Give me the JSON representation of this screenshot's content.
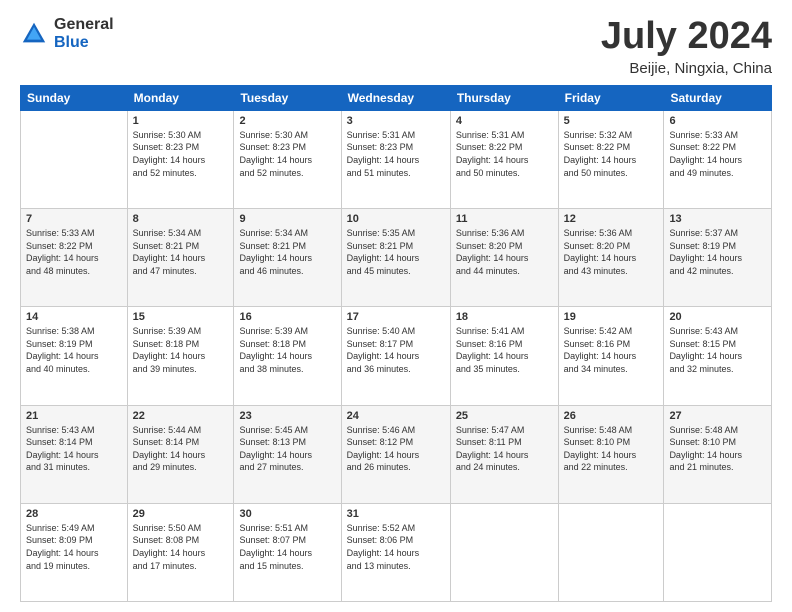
{
  "logo": {
    "general": "General",
    "blue": "Blue"
  },
  "header": {
    "title": "July 2024",
    "subtitle": "Beijie, Ningxia, China"
  },
  "weekdays": [
    "Sunday",
    "Monday",
    "Tuesday",
    "Wednesday",
    "Thursday",
    "Friday",
    "Saturday"
  ],
  "weeks": [
    [
      {
        "day": "",
        "content": ""
      },
      {
        "day": "1",
        "content": "Sunrise: 5:30 AM\nSunset: 8:23 PM\nDaylight: 14 hours\nand 52 minutes."
      },
      {
        "day": "2",
        "content": "Sunrise: 5:30 AM\nSunset: 8:23 PM\nDaylight: 14 hours\nand 52 minutes."
      },
      {
        "day": "3",
        "content": "Sunrise: 5:31 AM\nSunset: 8:23 PM\nDaylight: 14 hours\nand 51 minutes."
      },
      {
        "day": "4",
        "content": "Sunrise: 5:31 AM\nSunset: 8:22 PM\nDaylight: 14 hours\nand 50 minutes."
      },
      {
        "day": "5",
        "content": "Sunrise: 5:32 AM\nSunset: 8:22 PM\nDaylight: 14 hours\nand 50 minutes."
      },
      {
        "day": "6",
        "content": "Sunrise: 5:33 AM\nSunset: 8:22 PM\nDaylight: 14 hours\nand 49 minutes."
      }
    ],
    [
      {
        "day": "7",
        "content": "Sunrise: 5:33 AM\nSunset: 8:22 PM\nDaylight: 14 hours\nand 48 minutes."
      },
      {
        "day": "8",
        "content": "Sunrise: 5:34 AM\nSunset: 8:21 PM\nDaylight: 14 hours\nand 47 minutes."
      },
      {
        "day": "9",
        "content": "Sunrise: 5:34 AM\nSunset: 8:21 PM\nDaylight: 14 hours\nand 46 minutes."
      },
      {
        "day": "10",
        "content": "Sunrise: 5:35 AM\nSunset: 8:21 PM\nDaylight: 14 hours\nand 45 minutes."
      },
      {
        "day": "11",
        "content": "Sunrise: 5:36 AM\nSunset: 8:20 PM\nDaylight: 14 hours\nand 44 minutes."
      },
      {
        "day": "12",
        "content": "Sunrise: 5:36 AM\nSunset: 8:20 PM\nDaylight: 14 hours\nand 43 minutes."
      },
      {
        "day": "13",
        "content": "Sunrise: 5:37 AM\nSunset: 8:19 PM\nDaylight: 14 hours\nand 42 minutes."
      }
    ],
    [
      {
        "day": "14",
        "content": "Sunrise: 5:38 AM\nSunset: 8:19 PM\nDaylight: 14 hours\nand 40 minutes."
      },
      {
        "day": "15",
        "content": "Sunrise: 5:39 AM\nSunset: 8:18 PM\nDaylight: 14 hours\nand 39 minutes."
      },
      {
        "day": "16",
        "content": "Sunrise: 5:39 AM\nSunset: 8:18 PM\nDaylight: 14 hours\nand 38 minutes."
      },
      {
        "day": "17",
        "content": "Sunrise: 5:40 AM\nSunset: 8:17 PM\nDaylight: 14 hours\nand 36 minutes."
      },
      {
        "day": "18",
        "content": "Sunrise: 5:41 AM\nSunset: 8:16 PM\nDaylight: 14 hours\nand 35 minutes."
      },
      {
        "day": "19",
        "content": "Sunrise: 5:42 AM\nSunset: 8:16 PM\nDaylight: 14 hours\nand 34 minutes."
      },
      {
        "day": "20",
        "content": "Sunrise: 5:43 AM\nSunset: 8:15 PM\nDaylight: 14 hours\nand 32 minutes."
      }
    ],
    [
      {
        "day": "21",
        "content": "Sunrise: 5:43 AM\nSunset: 8:14 PM\nDaylight: 14 hours\nand 31 minutes."
      },
      {
        "day": "22",
        "content": "Sunrise: 5:44 AM\nSunset: 8:14 PM\nDaylight: 14 hours\nand 29 minutes."
      },
      {
        "day": "23",
        "content": "Sunrise: 5:45 AM\nSunset: 8:13 PM\nDaylight: 14 hours\nand 27 minutes."
      },
      {
        "day": "24",
        "content": "Sunrise: 5:46 AM\nSunset: 8:12 PM\nDaylight: 14 hours\nand 26 minutes."
      },
      {
        "day": "25",
        "content": "Sunrise: 5:47 AM\nSunset: 8:11 PM\nDaylight: 14 hours\nand 24 minutes."
      },
      {
        "day": "26",
        "content": "Sunrise: 5:48 AM\nSunset: 8:10 PM\nDaylight: 14 hours\nand 22 minutes."
      },
      {
        "day": "27",
        "content": "Sunrise: 5:48 AM\nSunset: 8:10 PM\nDaylight: 14 hours\nand 21 minutes."
      }
    ],
    [
      {
        "day": "28",
        "content": "Sunrise: 5:49 AM\nSunset: 8:09 PM\nDaylight: 14 hours\nand 19 minutes."
      },
      {
        "day": "29",
        "content": "Sunrise: 5:50 AM\nSunset: 8:08 PM\nDaylight: 14 hours\nand 17 minutes."
      },
      {
        "day": "30",
        "content": "Sunrise: 5:51 AM\nSunset: 8:07 PM\nDaylight: 14 hours\nand 15 minutes."
      },
      {
        "day": "31",
        "content": "Sunrise: 5:52 AM\nSunset: 8:06 PM\nDaylight: 14 hours\nand 13 minutes."
      },
      {
        "day": "",
        "content": ""
      },
      {
        "day": "",
        "content": ""
      },
      {
        "day": "",
        "content": ""
      }
    ]
  ]
}
